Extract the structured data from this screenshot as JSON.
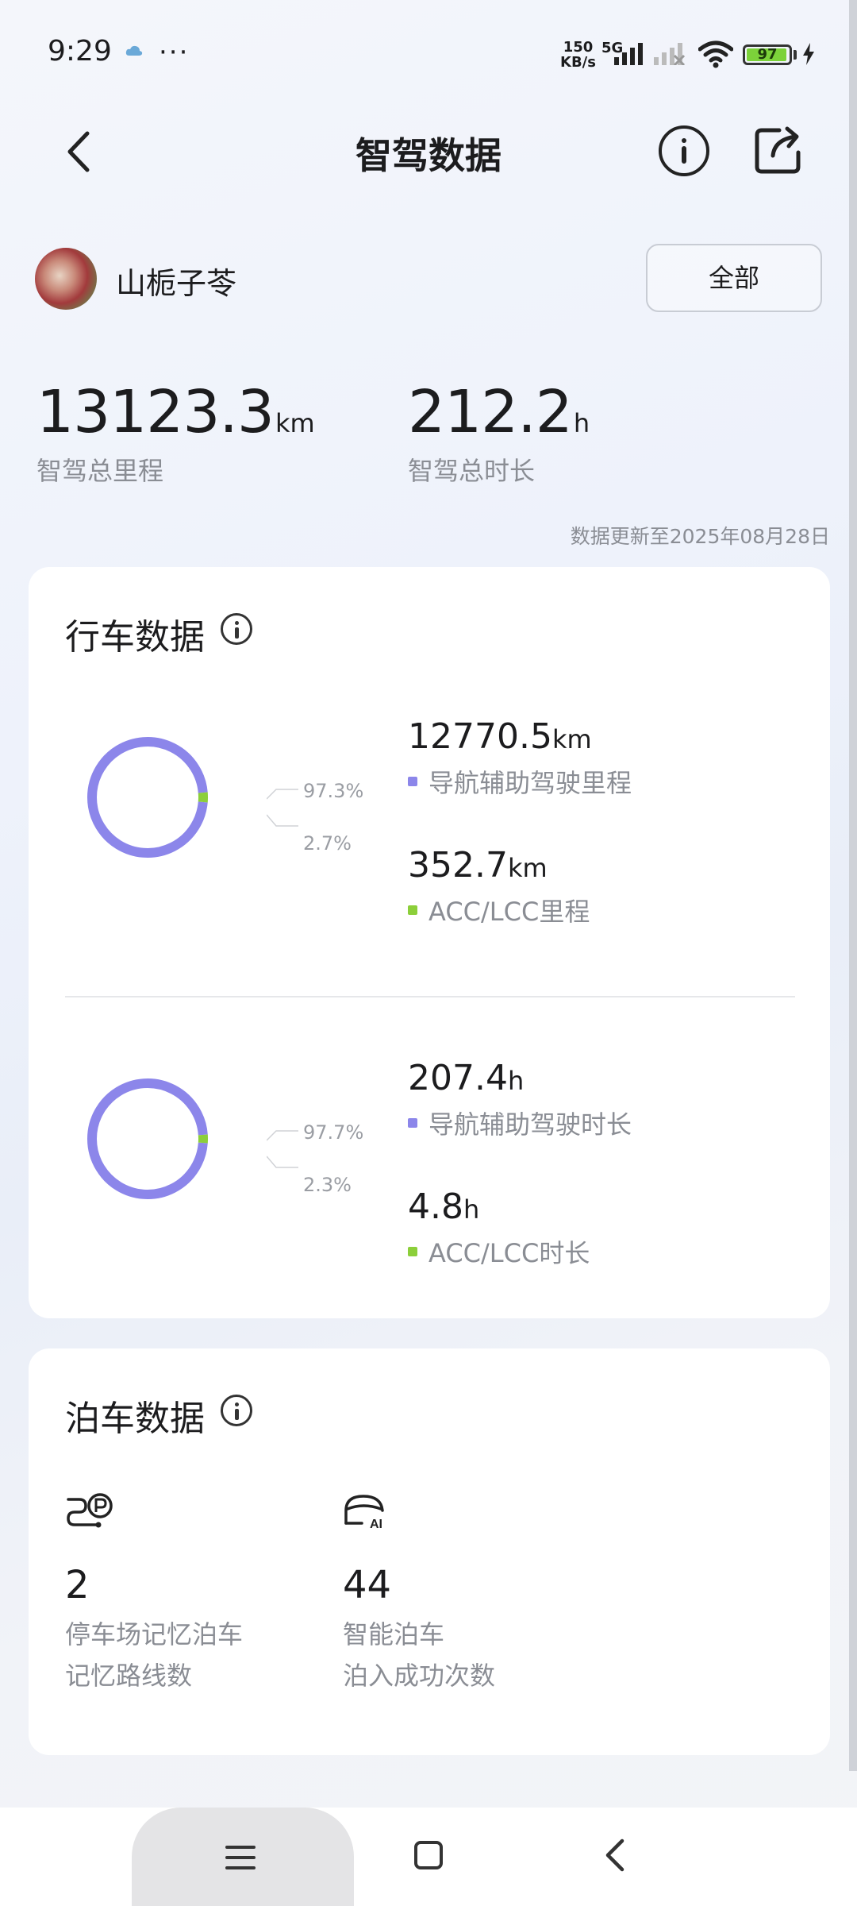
{
  "status_bar": {
    "time": "9:29",
    "net_speed_top": "150",
    "net_speed_bottom": "KB/s",
    "network_type": "5G",
    "battery": "97",
    "battery_level": 0.97
  },
  "header": {
    "title": "智驾数据"
  },
  "user": {
    "name": "山栀子苓",
    "filter_label": "全部"
  },
  "totals": {
    "mileage_value": "13123.3",
    "mileage_unit": "km",
    "mileage_label": "智驾总里程",
    "duration_value": "212.2",
    "duration_unit": "h",
    "duration_label": "智驾总时长",
    "update_note": "数据更新至2025年08月28日"
  },
  "driving": {
    "title": "行车数据",
    "mileage_chart": {
      "nav_pct_label": "97.3%",
      "acc_pct_label": "2.7%",
      "nav_fraction": 0.973,
      "nav_value": "12770.5",
      "nav_unit": "km",
      "nav_label": "导航辅助驾驶里程",
      "acc_value": "352.7",
      "acc_unit": "km",
      "acc_label": "ACC/LCC里程"
    },
    "duration_chart": {
      "nav_pct_label": "97.7%",
      "acc_pct_label": "2.3%",
      "nav_fraction": 0.977,
      "nav_value": "207.4",
      "nav_unit": "h",
      "nav_label": "导航辅助驾驶时长",
      "acc_value": "4.8",
      "acc_unit": "h",
      "acc_label": "ACC/LCC时长"
    },
    "colors": {
      "nav": "#8c86ea",
      "acc": "#8ccf3a"
    }
  },
  "parking": {
    "title": "泊车数据",
    "memory_icon": "parking-route-icon",
    "memory_value": "2",
    "memory_label_1": "停车场记忆泊车",
    "memory_label_2": "记忆路线数",
    "smart_icon": "ai-parking-icon",
    "smart_value": "44",
    "smart_label_1": "智能泊车",
    "smart_label_2": "泊入成功次数"
  }
}
